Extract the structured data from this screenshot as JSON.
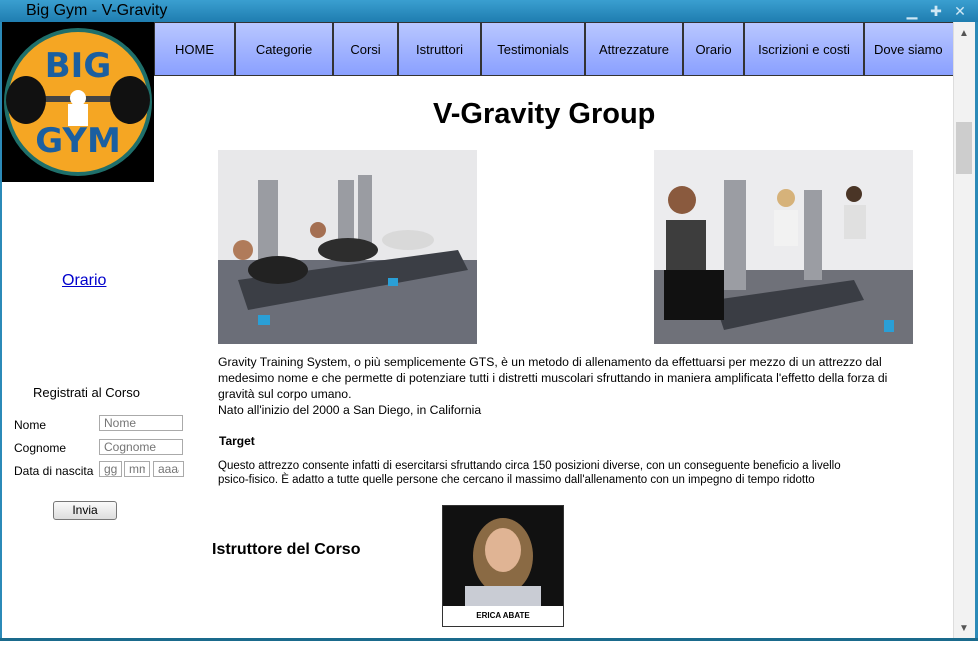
{
  "window": {
    "title": "Big Gym - V-Gravity"
  },
  "nav": {
    "items": [
      "HOME",
      "Categorie",
      "Corsi",
      "Istruttori",
      "Testimonials",
      "Attrezzature",
      "Orario",
      "Iscrizioni e costi",
      "Dove siamo"
    ]
  },
  "logo": {
    "text_top": "BIG",
    "text_bottom": "GYM"
  },
  "sidebar": {
    "orario_link": "Orario",
    "register": {
      "title": "Registrati al Corso",
      "nome_label": "Nome",
      "nome_placeholder": "Nome",
      "cognome_label": "Cognome",
      "cognome_placeholder": "Cognome",
      "nascita_label": "Data di nascita",
      "dd_placeholder": "gg",
      "mm_placeholder": "mm",
      "yyyy_placeholder": "aaaa",
      "submit_label": "Invia"
    }
  },
  "main": {
    "title": "V-Gravity Group",
    "intro_line1": "Gravity Training System, o più semplicemente GTS, è un metodo di allenamento da effettuarsi per mezzo di un attrezzo dal",
    "intro_line2": "medesimo nome e che permette di potenziare tutti i distretti muscolari sfruttando in maniera amplificata l'effetto della forza di",
    "intro_line3": "gravità sul corpo umano.",
    "intro_line4": "Nato all'inizio del 2000 a San Diego, in California",
    "target_title": "Target",
    "target_line1": "Questo attrezzo consente infatti di esercitarsi sfruttando circa 150 posizioni diverse, con un conseguente beneficio a livello",
    "target_line2": "psico-fisico. È adatto a tutte quelle persone che cercano il massimo dall'allenamento con un impegno di tempo ridotto",
    "instructor_title": "Istruttore del Corso",
    "instructor_name": "ERICA ABATE"
  },
  "colors": {
    "nav_bg": "#9aadff",
    "titlebar": "#2b8ab8",
    "logo_orange": "#f5a623",
    "link": "#0000cc"
  }
}
